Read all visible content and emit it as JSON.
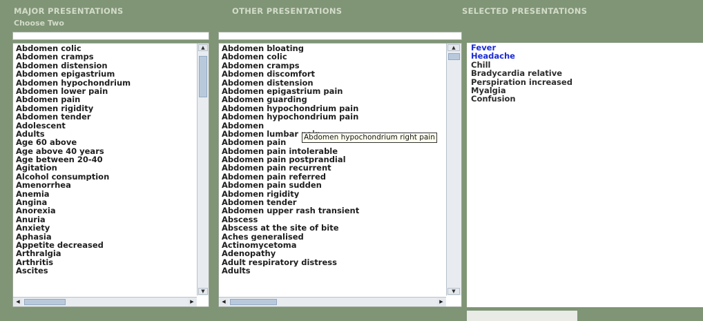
{
  "headers": {
    "major": "MAJOR PRESENTATIONS",
    "other": "OTHER PRESENTATIONS",
    "selected": "SELECTED PRESENTATIONS",
    "subtitle": "Choose Two"
  },
  "colors": {
    "background": "#7f9576",
    "selected_highlight": "#1a2ad6"
  },
  "major_list": [
    "Abdomen colic",
    "Abdomen cramps",
    "Abdomen distension",
    "Abdomen epigastrium",
    "Abdomen hypochondrium",
    "Abdomen lower pain",
    "Abdomen pain",
    "Abdomen rigidity",
    "Abdomen tender",
    "Adolescent",
    "Adults",
    "Age 60 above",
    "Age above 40 years",
    "Age between 20-40",
    "Agitation",
    "Alcohol consumption",
    "Amenorrhea",
    "Anemia",
    "Angina",
    "Anorexia",
    "Anuria",
    "Anxiety",
    "Aphasia",
    "Appetite decreased",
    "Arthralgia",
    "Arthritis",
    "Ascites"
  ],
  "other_list": [
    "Abdomen bloating",
    "Abdomen colic",
    "Abdomen cramps",
    "Abdomen discomfort",
    "Abdomen distension",
    "Abdomen epigastrium pain",
    "Abdomen guarding",
    "Abdomen hypochondrium pain",
    "Abdomen hypochondrium pain",
    "Abdomen",
    "Abdomen lumbar pain",
    "Abdomen pain",
    "Abdomen pain intolerable",
    "Abdomen pain postprandial",
    "Abdomen pain recurrent",
    "Abdomen pain referred",
    "Abdomen pain sudden",
    "Abdomen rigidity",
    "Abdomen tender",
    "Abdomen upper rash transient",
    "Abscess",
    "Abscess at the site of bite",
    "Aches generalised",
    "Actinomycetoma",
    "Adenopathy",
    "Adult respiratory distress",
    "Adults"
  ],
  "tooltip": "Abdomen hypochondrium right pain",
  "selected_list": [
    {
      "label": "Fever",
      "highlighted": true
    },
    {
      "label": "Headache",
      "highlighted": true
    },
    {
      "label": "Chill",
      "highlighted": false
    },
    {
      "label": "Bradycardia relative",
      "highlighted": false
    },
    {
      "label": "Perspiration increased",
      "highlighted": false
    },
    {
      "label": "Myalgia",
      "highlighted": false
    },
    {
      "label": "Confusion",
      "highlighted": false
    }
  ]
}
